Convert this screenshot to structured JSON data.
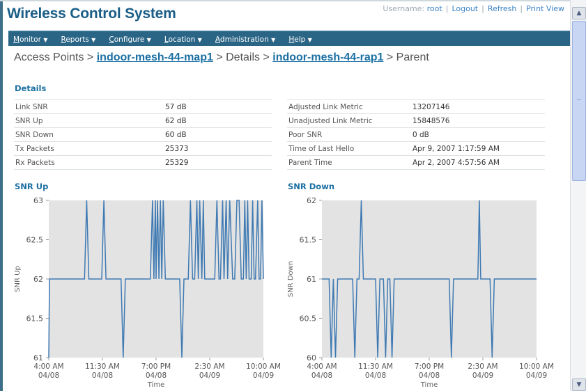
{
  "app": {
    "title": "Wireless Control System"
  },
  "userbar": {
    "username_label": "Username:",
    "username": "root",
    "logout": "Logout",
    "refresh": "Refresh",
    "print_view": "Print View",
    "separator": "|"
  },
  "menu": [
    {
      "mnemonic": "M",
      "rest": "onitor"
    },
    {
      "mnemonic": "R",
      "rest": "eports"
    },
    {
      "mnemonic": "C",
      "rest": "onfigure"
    },
    {
      "mnemonic": "L",
      "rest": "ocation"
    },
    {
      "mnemonic": "A",
      "rest": "dministration"
    },
    {
      "mnemonic": "H",
      "rest": "elp"
    }
  ],
  "menu_arrow": "▼",
  "breadcrumb": {
    "root": "Access Points >",
    "ap_map": "indoor-mesh-44-map1",
    "details": "> Details >",
    "ap_rap": "indoor-mesh-44-rap1",
    "current": "> Parent"
  },
  "details": {
    "title": "Details",
    "left": [
      {
        "label": "Link SNR",
        "value": "57 dB"
      },
      {
        "label": "SNR Up",
        "value": "62 dB"
      },
      {
        "label": "SNR Down",
        "value": "60 dB"
      },
      {
        "label": "Tx Packets",
        "value": "25373"
      },
      {
        "label": "Rx Packets",
        "value": "25329"
      }
    ],
    "right": [
      {
        "label": "Adjusted Link Metric",
        "value": "13207146"
      },
      {
        "label": "Unadjusted Link Metric",
        "value": "15848576"
      },
      {
        "label": "Poor SNR",
        "value": "0 dB"
      },
      {
        "label": "Time of Last Hello",
        "value": "Apr 9, 2007 1:17:59 AM"
      },
      {
        "label": "Parent Time",
        "value": "Apr 2, 2007 4:57:56 AM"
      }
    ]
  },
  "colors": {
    "line": "#3f7ab3",
    "plot_bg": "#e3e3e3",
    "title": "#1b6fa3",
    "menubar": "#2b6586"
  },
  "chart_data": [
    {
      "type": "line",
      "title": "SNR Up",
      "xlabel": "Time",
      "ylabel": "SNR Up",
      "ylim": [
        61,
        63
      ],
      "yticks": [
        61,
        61.5,
        62,
        62.5,
        63
      ],
      "ytick_labels": [
        "61",
        "61.5",
        "62",
        "62.5",
        "63"
      ],
      "xlim": [
        0,
        30
      ],
      "xticks": [
        0,
        7.5,
        15,
        22.5,
        30
      ],
      "xtick_labels": [
        [
          "4:00 AM",
          "04/08"
        ],
        [
          "11:30 AM",
          "04/08"
        ],
        [
          "7:00 PM",
          "04/08"
        ],
        [
          "2:30 AM",
          "04/09"
        ],
        [
          "10:00 AM",
          "04/09"
        ]
      ],
      "x": [
        0,
        0.1,
        0.3,
        5.0,
        5.3,
        5.6,
        7.4,
        7.7,
        8.0,
        10.1,
        10.4,
        10.7,
        10.9,
        11.3,
        14.2,
        14.5,
        14.7,
        14.9,
        15.0,
        15.2,
        15.4,
        15.6,
        15.8,
        16.0,
        16.3,
        18.3,
        18.6,
        18.9,
        19.5,
        19.8,
        20.1,
        20.4,
        20.7,
        20.9,
        21.1,
        21.4,
        21.6,
        21.8,
        22.1,
        23.2,
        23.5,
        23.8,
        24.0,
        24.3,
        24.5,
        24.8,
        25.0,
        25.3,
        25.7,
        26.0,
        26.3,
        26.6,
        26.9,
        27.2,
        27.4,
        27.6,
        27.8,
        28.0,
        28.3,
        28.5,
        28.7,
        28.9,
        29.2,
        29.4,
        29.6,
        29.8,
        30.0
      ],
      "series": [
        {
          "values": [
            61,
            62,
            62,
            62,
            63,
            62,
            62,
            63,
            62,
            62,
            61,
            62,
            62,
            62,
            62,
            63,
            62,
            63,
            62,
            63,
            62,
            63,
            62,
            63,
            62,
            62,
            61,
            62,
            62,
            63,
            62,
            62,
            63,
            62,
            63,
            62,
            63,
            62,
            62,
            62,
            63,
            62,
            62,
            63,
            62,
            63,
            62,
            63,
            62,
            62,
            63,
            63,
            62,
            62,
            63,
            62,
            63,
            62,
            62,
            63,
            62,
            62,
            63,
            62,
            62,
            63,
            62
          ]
        }
      ]
    },
    {
      "type": "line",
      "title": "SNR Down",
      "xlabel": "Time",
      "ylabel": "SNR Down",
      "ylim": [
        60,
        62
      ],
      "yticks": [
        60,
        60.5,
        61,
        61.5,
        62
      ],
      "ytick_labels": [
        "60",
        "60.5",
        "61",
        "61.5",
        "62"
      ],
      "xlim": [
        0,
        30
      ],
      "xticks": [
        0,
        7.5,
        15,
        22.5,
        30
      ],
      "xtick_labels": [
        [
          "4:00 AM",
          "04/08"
        ],
        [
          "11:30 AM",
          "04/08"
        ],
        [
          "7:00 PM",
          "04/08"
        ],
        [
          "2:30 AM",
          "04/09"
        ],
        [
          "10:00 AM",
          "04/09"
        ]
      ],
      "x": [
        0,
        1.0,
        1.3,
        1.6,
        1.9,
        2.2,
        4.3,
        4.6,
        4.9,
        5.2,
        5.5,
        5.8,
        6.1,
        7.5,
        7.8,
        8.1,
        8.6,
        8.9,
        9.2,
        9.5,
        9.8,
        10.1,
        17.8,
        18.1,
        18.4,
        21.8,
        22.0,
        22.2,
        22.5,
        23.5,
        23.8,
        24.1,
        30.0
      ],
      "series": [
        {
          "values": [
            61,
            61,
            60,
            61,
            60,
            61,
            61,
            60,
            61,
            61,
            62,
            61,
            61,
            61,
            60,
            61,
            61,
            60,
            61,
            61,
            60,
            61,
            61,
            60,
            61,
            61,
            62,
            61,
            61,
            61,
            60,
            61,
            61
          ]
        }
      ]
    }
  ]
}
